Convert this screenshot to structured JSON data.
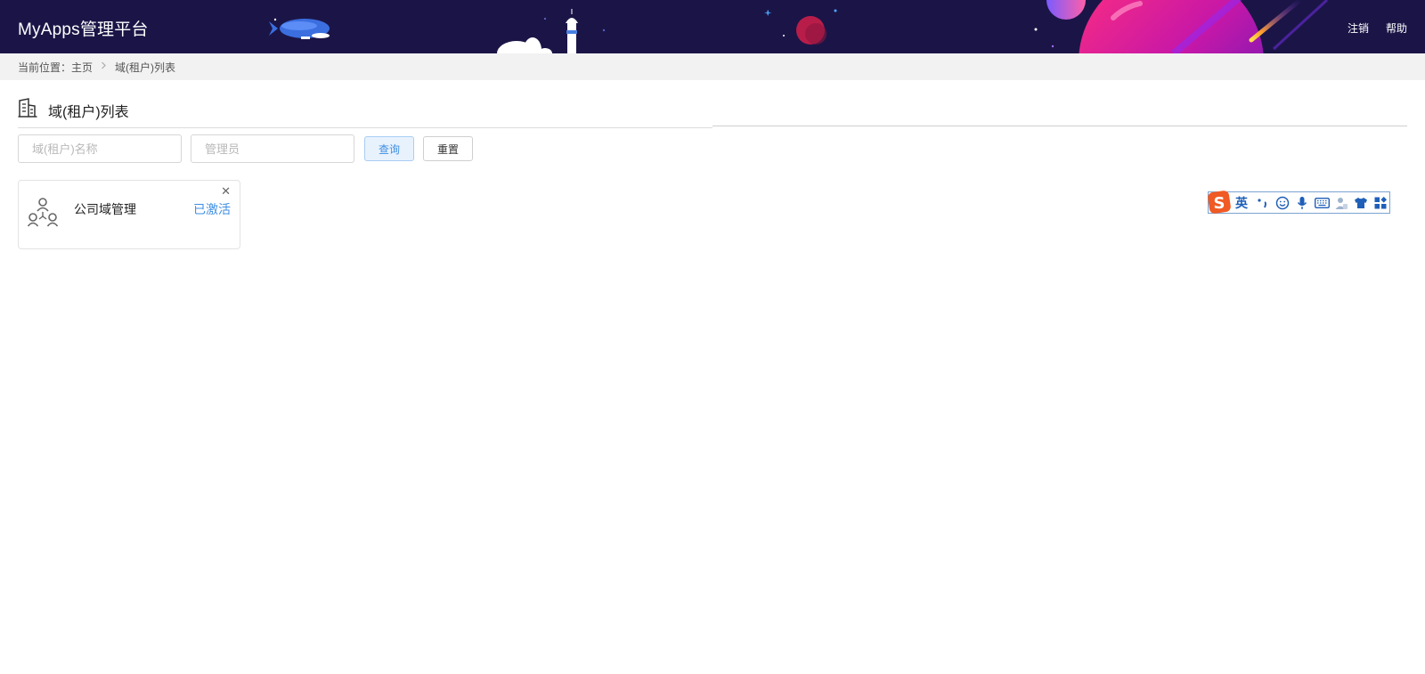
{
  "header": {
    "brand": "MyApps管理平台",
    "links": [
      {
        "label": "注销"
      },
      {
        "label": "帮助"
      }
    ],
    "colors": {
      "background": "#1b1547"
    }
  },
  "breadcrumb": {
    "prefix": "当前位置：",
    "items": [
      {
        "label": "主页"
      },
      {
        "label": "域(租户)列表"
      }
    ]
  },
  "page": {
    "title": "域(租户)列表",
    "title_icon": "building-icon"
  },
  "search": {
    "domain_name_placeholder": "域(租户)名称",
    "domain_name_value": "",
    "admin_placeholder": "管理员",
    "admin_value": "",
    "query_label": "查询",
    "reset_label": "重置"
  },
  "cards": [
    {
      "icon": "users-network-icon",
      "title": "公司域管理",
      "status": "已激活",
      "status_color": "#3f8fe2"
    }
  ],
  "ime_toolbar": {
    "language": "英",
    "icons": [
      "punctuation-icon",
      "emoji-icon",
      "microphone-icon",
      "keyboard-icon",
      "user-icon",
      "skin-icon",
      "grid-menu-icon"
    ]
  }
}
